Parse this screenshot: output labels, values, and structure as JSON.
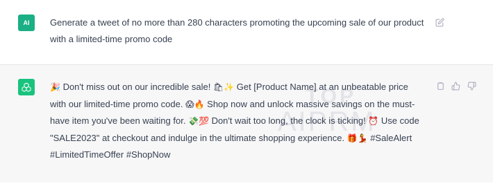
{
  "user_message": {
    "avatar_text": "AI",
    "text": "Generate a tweet of no more than 280 characters promoting the upcoming sale of our product with a limited-time promo code"
  },
  "assistant_message": {
    "segments": [
      {
        "emoji": "🎉"
      },
      {
        "text": " Don't miss out on our incredible sale! "
      },
      {
        "emoji": "🛍"
      },
      {
        "emoji": "✨"
      },
      {
        "text": " Get [Product Name] at an unbeatable price with our limited-time promo code. "
      },
      {
        "emoji": "😱"
      },
      {
        "emoji": "🔥"
      },
      {
        "text": " Shop now and unlock massive savings on the must-have item you've been waiting for. "
      },
      {
        "emoji": "💸"
      },
      {
        "emoji": "💯"
      },
      {
        "text": " Don't wait too long, the clock is ticking! "
      },
      {
        "emoji": "⏰"
      },
      {
        "text": " Use code \"SALE2023\" at checkout and indulge in the ultimate shopping experience. "
      },
      {
        "emoji": "🎁"
      },
      {
        "emoji": "💃"
      },
      {
        "text": " #SaleAlert #LimitedTimeOffer #ShopNow"
      }
    ]
  },
  "watermark": {
    "top_text": "TOP",
    "brand_text": "AIPRM"
  },
  "icons": {
    "edit": "edit-icon",
    "copy": "copy-icon",
    "thumbs_up": "thumbs-up-icon",
    "thumbs_down": "thumbs-down-icon",
    "assistant_logo": "openai-logo-icon"
  }
}
